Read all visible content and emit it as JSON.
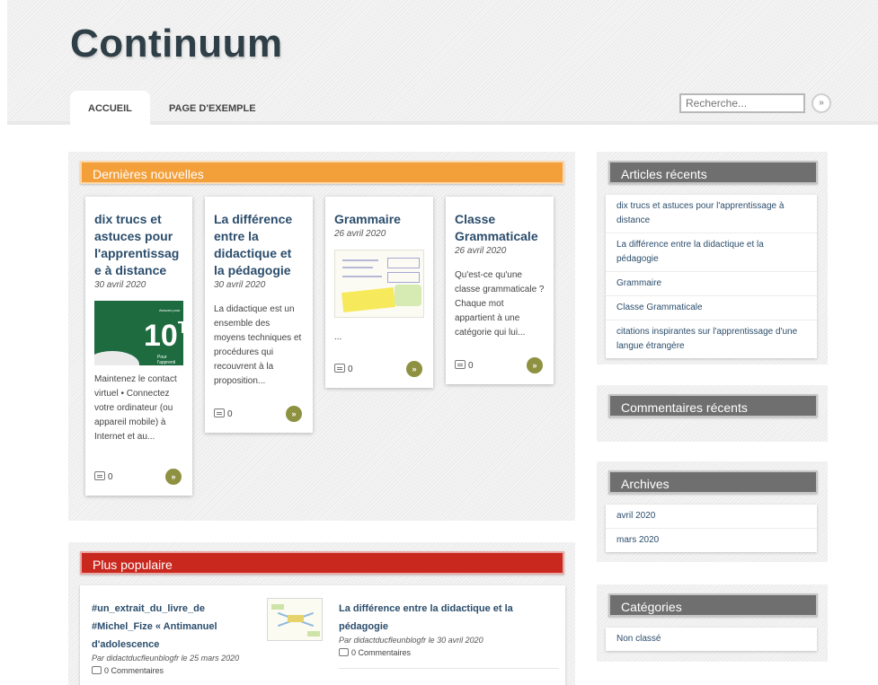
{
  "site": {
    "title": "Continuum"
  },
  "nav": {
    "tabs": [
      {
        "label": "ACCUEIL"
      },
      {
        "label": "PAGE D'EXEMPLE"
      }
    ],
    "search_placeholder": "Recherche...",
    "search_button_icon": "»"
  },
  "latest": {
    "heading": "Dernières nouvelles",
    "posts": [
      {
        "title": "dix trucs et astuces pour l'apprentissag e à distance",
        "date": "30 avril 2020",
        "excerpt": "Maintenez le contact virtuel • Connectez votre ordinateur (ou appareil mobile) à Internet et au...",
        "comments": "0",
        "thumb": {
          "number": "10",
          "letter": "T",
          "tag": "Astuces pour",
          "sub": "Pour l'apprenti"
        }
      },
      {
        "title": "La différence entre la didactique et la pédagogie",
        "date": "30 avril 2020",
        "excerpt": "La didactique est un ensemble des moyens techniques et procédures qui recouvrent à la proposition...",
        "comments": "0"
      },
      {
        "title": "Grammaire",
        "date": "26 avril 2020",
        "excerpt": "...",
        "comments": "0"
      },
      {
        "title": "Classe Grammaticale",
        "date": "26 avril 2020",
        "excerpt": "Qu'est-ce qu'une classe grammaticale ? Chaque mot appartient à une catégorie qui lui...",
        "comments": "0"
      }
    ],
    "more_icon": "»"
  },
  "popular": {
    "heading": "Plus populaire",
    "items": [
      {
        "title": "#un_extrait_du_livre_de #Michel_Fize « Antimanuel d'adolescence",
        "meta": "Par didactducfleunblogfr le 25 mars 2020",
        "comments": "0 Commentaires"
      },
      {
        "title": "La différence entre la didactique et la pédagogie",
        "meta": "Par didactducfleunblogfr le 30 avril 2020",
        "comments": "0 Commentaires"
      }
    ]
  },
  "sidebar": {
    "recent_articles": {
      "heading": "Articles récents",
      "items": [
        "dix trucs et astuces pour l'apprentissage à distance",
        "La différence entre la didactique et la pédagogie",
        "Grammaire",
        "Classe Grammaticale",
        "citations inspirantes sur l'apprentissage d'une langue étrangère"
      ]
    },
    "recent_comments": {
      "heading": "Commentaires récents"
    },
    "archives": {
      "heading": "Archives",
      "items": [
        "avril 2020",
        "mars 2020"
      ]
    },
    "categories": {
      "heading": "Catégories",
      "items": [
        "Non classé"
      ]
    }
  }
}
